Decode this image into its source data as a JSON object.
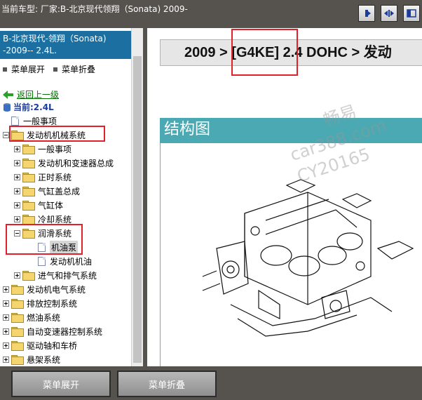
{
  "topbar": {
    "title": "当前车型:  厂家:B-北京现代领翔（Sonata) 2009-"
  },
  "sidebar": {
    "header_line1": "B-北京现代-领翔（Sonata)",
    "header_line2": "-2009-- 2.4L.",
    "expand_label": "菜单展开",
    "collapse_label": "菜单折叠",
    "back_label": "返回上一级",
    "current_label": "当前:2.4L",
    "tree": {
      "general": "一般事项",
      "engine_mech": "发动机机械系统",
      "sub": [
        "一般事项",
        "发动机和变速器总成",
        "正时系统",
        "气缸盖总成",
        "气缸体",
        "冷却系统"
      ],
      "lubrication": "润滑系统",
      "oil_pump": "机油泵",
      "engine_oil": "发动机机油",
      "intake_exhaust": "进气和排气系统",
      "top": [
        "发动机电气系统",
        "排放控制系统",
        "燃油系统",
        "自动变速器控制系统",
        "驱动轴和车桥",
        "悬架系统"
      ]
    }
  },
  "content": {
    "breadcrumb": {
      "year": "2009 > ",
      "engine": "[G4KE]",
      "rest": " 2.4 DOHC > 发动"
    },
    "section_title": "结构图",
    "watermark_line1": "畅易",
    "watermark_line2": "car388.com",
    "watermark_line3": "CY20165"
  },
  "bottom": {
    "expand_label": "菜单展开",
    "collapse_label": "菜单折叠"
  },
  "colors": {
    "accent_blue": "#1b6fa1",
    "highlight_red": "#e0202a",
    "section_teal": "#4aa9b3"
  }
}
